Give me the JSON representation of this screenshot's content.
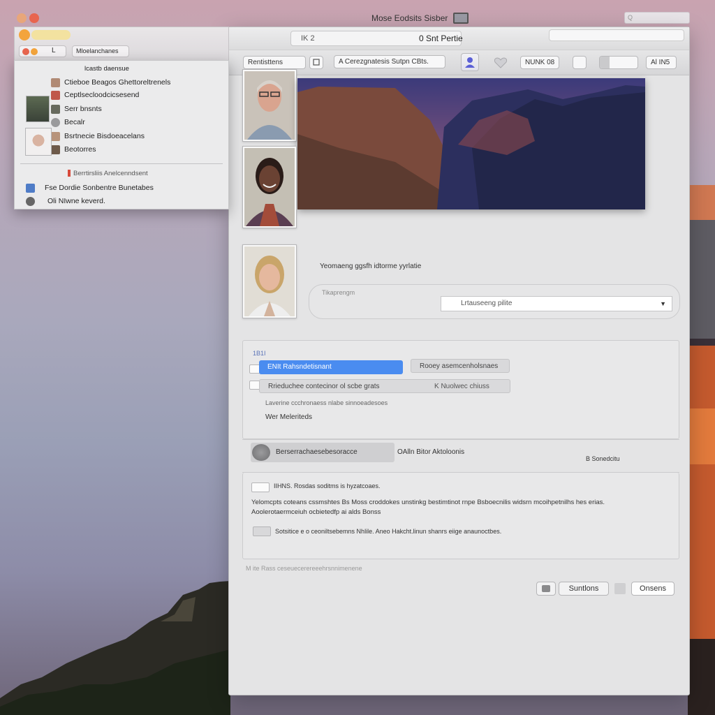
{
  "desktop": {
    "menubar_title": "Mose Eodsits Sisber",
    "search_hint": "Q"
  },
  "left_window": {
    "tab_label": "Mloelanchanes",
    "badge": "L"
  },
  "window": {
    "segment_label": "IK 2",
    "title": "0 Snt Pertie"
  },
  "toolbar": {
    "edit_label": "Rentisttens",
    "search_field": "A Cerezgnatesis Sutpn CBts.",
    "mode_label": "NUNK 08",
    "small_label": "Al IN5"
  },
  "profile": {
    "caption": "Yeomaeng ggsfh idtorme yyrlatie",
    "select_placeholder": "Lrtauseeng pilite",
    "select_hint": "Tikaprengm"
  },
  "options": {
    "group_label": "1B1I",
    "primary_option": "ENIt Rahsndetisnant",
    "primary_side": "Rooey asemcenholsnaes",
    "secondary_option": "Rrieduchee contecinor ol scbe grats",
    "secondary_side": "K Nuolwec chiuss",
    "note": "Laverine ccchronaess nlabe sinnoeadesoes",
    "footer": "Wer Meleriteds"
  },
  "storage": {
    "slider_label": "Berserrachaesebesoracce",
    "slider_side": "OAlln Bitor Aktoloonis",
    "right_label": "B Sonedcitu"
  },
  "description": {
    "heading": "IIHNS. Rosdas soditms is hyzatcoaes.",
    "body_line1": "Yelomcpts coteans cssmshtes Bs Moss croddokes unstinkg bestimtinot rnpe Bsboecnilis widsrn mcoihpetnilhs hes erias.",
    "body_line2": "Aoolerotaermceiuh ocbietedfp ai alds Bonss",
    "option_text": "Sotsitice e o ceoniltsebemns Nhlile. Aneo Hakcht.linun shanrs eiige anaunoctbes."
  },
  "footer": {
    "hint": "M ite Rass ceseuecerereeehrsnnimenene",
    "cancel_label": "Suntlons",
    "ok_label": "Onsens"
  },
  "dropdown": {
    "header": "lcastb daensue",
    "items": [
      "Ctieboe Beagos Ghettoreltrenels",
      "Ceptlsecloodcicsesend",
      "Serr bnsnts",
      "Becalr",
      "Bsrtnecie Bisdoeacelans",
      "Beotorres"
    ],
    "separator_label": "Berrtirsliis Anelcenndsent",
    "footer_items": [
      "Fse Dordie Sonbentre Bunetabes",
      "Oli NIwne keverd."
    ]
  },
  "colors": {
    "accent": "#4a8cf0",
    "window_bg": "#e4e4e5",
    "traffic_red": "#e8654f",
    "traffic_orange": "#f3a43c"
  }
}
